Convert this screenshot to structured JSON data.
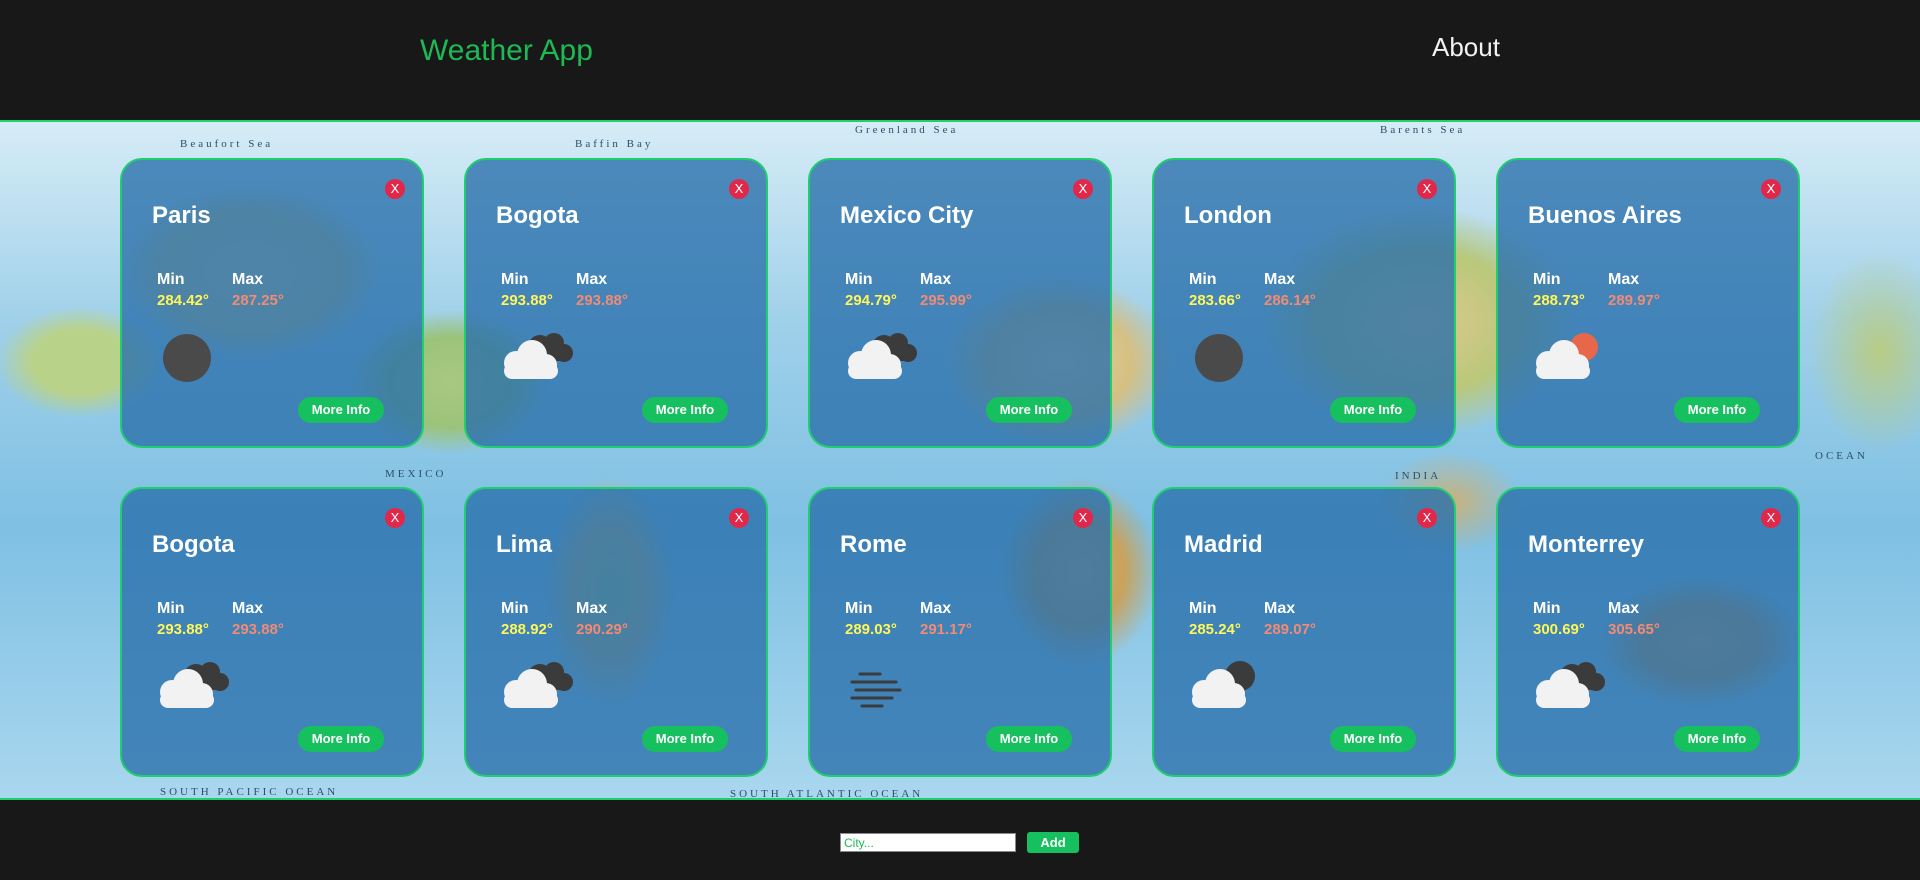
{
  "header": {
    "title": "Weather App",
    "about_label": "About"
  },
  "map": {
    "labels": [
      "Beaufort Sea",
      "Baffin Bay",
      "Greenland Sea",
      "Barents Sea",
      "SOUTH PACIFIC OCEAN",
      "SOUTH ATLANTIC OCEAN",
      "MEXICO",
      "INDIA",
      "OCEAN"
    ]
  },
  "labels": {
    "min": "Min",
    "max": "Max",
    "more_info": "More Info",
    "close": "X"
  },
  "cards": [
    {
      "city": "Paris",
      "min": "284.42°",
      "max": "287.25°",
      "icon": "dark-circle-icon"
    },
    {
      "city": "Bogota",
      "min": "293.88°",
      "max": "293.88°",
      "icon": "cloud-dark-cloud-icon"
    },
    {
      "city": "Mexico City",
      "min": "294.79°",
      "max": "295.99°",
      "icon": "cloud-dark-cloud-icon"
    },
    {
      "city": "London",
      "min": "283.66°",
      "max": "286.14°",
      "icon": "dark-circle-icon"
    },
    {
      "city": "Buenos Aires",
      "min": "288.73°",
      "max": "289.97°",
      "icon": "cloud-sun-icon"
    },
    {
      "city": "Bogota",
      "min": "293.88°",
      "max": "293.88°",
      "icon": "cloud-dark-cloud-icon"
    },
    {
      "city": "Lima",
      "min": "288.92°",
      "max": "290.29°",
      "icon": "cloud-dark-cloud-icon"
    },
    {
      "city": "Rome",
      "min": "289.03°",
      "max": "291.17°",
      "icon": "fog-icon"
    },
    {
      "city": "Madrid",
      "min": "285.24°",
      "max": "289.07°",
      "icon": "cloud-moon-icon"
    },
    {
      "city": "Monterrey",
      "min": "300.69°",
      "max": "305.65°",
      "icon": "cloud-dark-cloud-icon"
    }
  ],
  "footer": {
    "placeholder": "City...",
    "value": "",
    "add_label": "Add"
  },
  "colors": {
    "accent": "#1db954",
    "card_bg": "#286eaa",
    "close": "#e0294a",
    "min": "#fff65a",
    "max": "#f28b76",
    "sun": "#e8674a"
  }
}
